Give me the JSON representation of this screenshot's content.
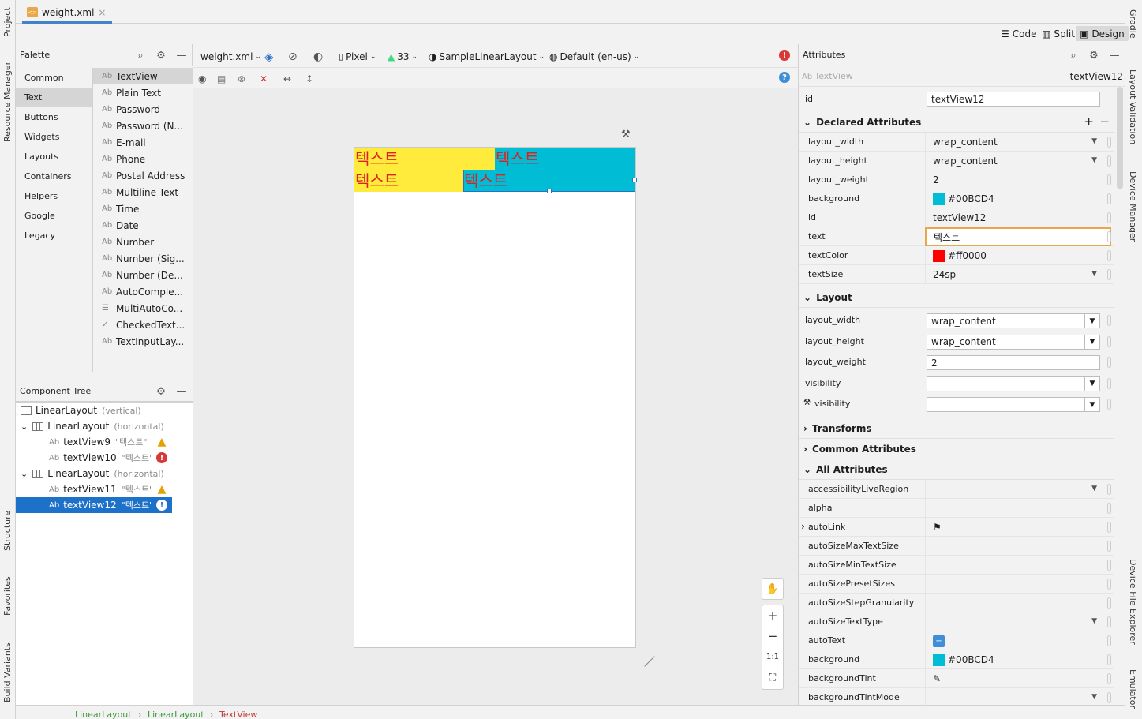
{
  "left_strip": {
    "project": "Project",
    "resource_manager": "Resource Manager",
    "structure": "Structure",
    "favorites": "Favorites",
    "build_variants": "Build Variants"
  },
  "right_strip": {
    "gradle": "Gradle",
    "layout_validation": "Layout Validation",
    "device_manager": "Device Manager",
    "device_file_explorer": "Device File Explorer",
    "emulator": "Emulator"
  },
  "file_tab": {
    "name": "weight.xml",
    "close": "×"
  },
  "modes": {
    "code": "Code",
    "split": "Split",
    "design": "Design"
  },
  "palette": {
    "title": "Palette",
    "categories": [
      "Common",
      "Text",
      "Buttons",
      "Widgets",
      "Layouts",
      "Containers",
      "Helpers",
      "Google",
      "Legacy"
    ],
    "selected_category": "Text",
    "widgets": [
      {
        "icon": "Ab",
        "label": "TextView"
      },
      {
        "icon": "Ab",
        "label": "Plain Text"
      },
      {
        "icon": "Ab",
        "label": "Password"
      },
      {
        "icon": "Ab",
        "label": "Password (N..."
      },
      {
        "icon": "Ab",
        "label": "E-mail"
      },
      {
        "icon": "Ab",
        "label": "Phone"
      },
      {
        "icon": "Ab",
        "label": "Postal Address"
      },
      {
        "icon": "Ab",
        "label": "Multiline Text"
      },
      {
        "icon": "Ab",
        "label": "Time"
      },
      {
        "icon": "Ab",
        "label": "Date"
      },
      {
        "icon": "Ab",
        "label": "Number"
      },
      {
        "icon": "Ab",
        "label": "Number (Sig..."
      },
      {
        "icon": "Ab",
        "label": "Number (De..."
      },
      {
        "icon": "Ab",
        "label": "AutoComple..."
      },
      {
        "icon": "☰",
        "label": "MultiAutoCo..."
      },
      {
        "icon": "✓",
        "label": "CheckedText..."
      },
      {
        "icon": "Ab",
        "label": "TextInputLay..."
      }
    ]
  },
  "component_tree": {
    "title": "Component Tree",
    "rows": [
      {
        "label": "LinearLayout",
        "hint": "(vertical)",
        "status": "none"
      },
      {
        "label": "LinearLayout",
        "hint": "(horizontal)",
        "status": "none"
      },
      {
        "label": "textView9",
        "hint": "\"텍스트\"",
        "status": "warning"
      },
      {
        "label": "textView10",
        "hint": "\"텍스트\"",
        "status": "error"
      },
      {
        "label": "LinearLayout",
        "hint": "(horizontal)",
        "status": "none"
      },
      {
        "label": "textView11",
        "hint": "\"텍스트\"",
        "status": "warning"
      },
      {
        "label": "textView12",
        "hint": "\"텍스트\"",
        "status": "error"
      }
    ]
  },
  "canvas_toolbar": {
    "file": "weight.xml",
    "device": "Pixel",
    "api": "33",
    "theme": "SampleLinearLayout",
    "locale": "Default (en-us)"
  },
  "preview": {
    "row1": [
      "텍스트",
      "텍스트"
    ],
    "row2": [
      "텍스트",
      "텍스트"
    ]
  },
  "zoom": {
    "one_to_one": "1:1"
  },
  "attributes": {
    "title": "Attributes",
    "widget_type": "TextView",
    "widget_id": "textView12",
    "id_label": "id",
    "id_value": "textView12",
    "declared_title": "Declared Attributes",
    "declared": [
      {
        "name": "layout_width",
        "value": "wrap_content",
        "dropdown": true
      },
      {
        "name": "layout_height",
        "value": "wrap_content",
        "dropdown": true
      },
      {
        "name": "layout_weight",
        "value": "2",
        "dropdown": false
      },
      {
        "name": "background",
        "value": "#00BCD4",
        "dropdown": false,
        "swatch": "#00BCD4"
      },
      {
        "name": "id",
        "value": "textView12",
        "dropdown": false
      },
      {
        "name": "text",
        "value": "텍스트",
        "dropdown": false
      },
      {
        "name": "textColor",
        "value": "#ff0000",
        "dropdown": false,
        "swatch": "#ff0000"
      },
      {
        "name": "textSize",
        "value": "24sp",
        "dropdown": true
      }
    ],
    "layout_title": "Layout",
    "layout": [
      {
        "name": "layout_width",
        "value": "wrap_content"
      },
      {
        "name": "layout_height",
        "value": "wrap_content"
      },
      {
        "name": "layout_weight",
        "value": "2"
      },
      {
        "name": "visibility",
        "value": ""
      },
      {
        "name": "visibility",
        "value": ""
      }
    ],
    "transforms_title": "Transforms",
    "common_title": "Common Attributes",
    "all_title": "All Attributes",
    "all": [
      {
        "name": "accessibilityLiveRegion",
        "value": "",
        "dropdown": true
      },
      {
        "name": "alpha",
        "value": ""
      },
      {
        "name": "autoLink",
        "value": "⚑"
      },
      {
        "name": "autoSizeMaxTextSize",
        "value": ""
      },
      {
        "name": "autoSizeMinTextSize",
        "value": ""
      },
      {
        "name": "autoSizePresetSizes",
        "value": ""
      },
      {
        "name": "autoSizeStepGranularity",
        "value": ""
      },
      {
        "name": "autoSizeTextType",
        "value": "",
        "dropdown": true
      },
      {
        "name": "autoText",
        "value": ""
      },
      {
        "name": "background",
        "value": "#00BCD4",
        "swatch": "#00BCD4"
      },
      {
        "name": "backgroundTint",
        "value": ""
      },
      {
        "name": "backgroundTintMode",
        "value": "",
        "dropdown": true
      }
    ]
  },
  "breadcrumb": [
    "LinearLayout",
    "LinearLayout",
    "TextView"
  ],
  "colors": {
    "accent": "#4083c9",
    "selection": "#1e71c9",
    "yellow": "#FFEB3B",
    "cyan": "#00BCD4",
    "text_red": "#ff0000"
  }
}
